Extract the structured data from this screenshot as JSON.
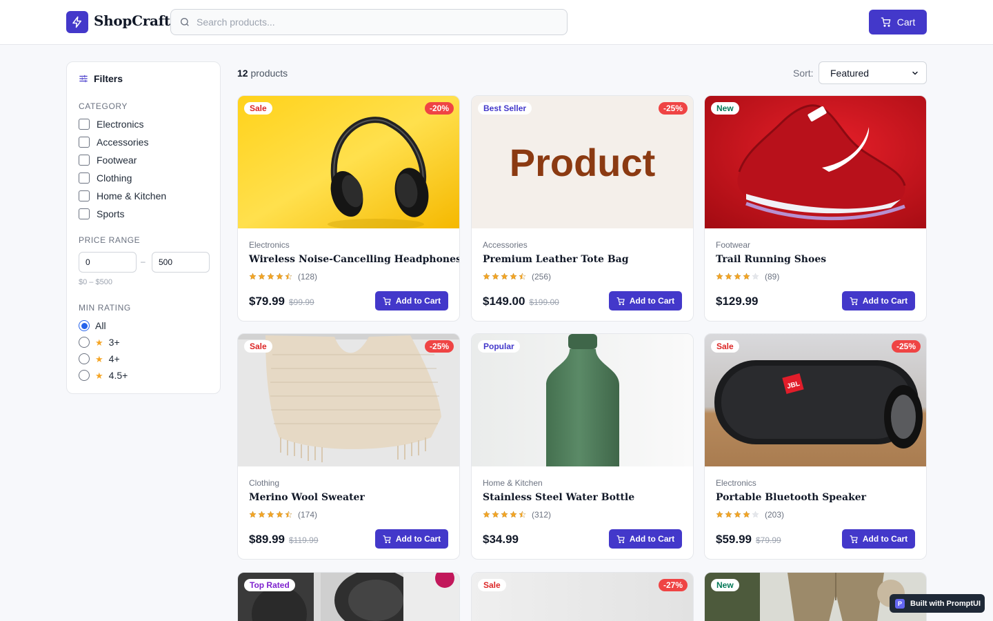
{
  "header": {
    "brand": "ShopCraft",
    "search_placeholder": "Search products...",
    "cart_label": "Cart"
  },
  "filters": {
    "title": "Filters",
    "category_label": "CATEGORY",
    "categories": [
      "Electronics",
      "Accessories",
      "Footwear",
      "Clothing",
      "Home & Kitchen",
      "Sports"
    ],
    "price_label": "PRICE RANGE",
    "price_min": "0",
    "price_max": "500",
    "price_dash": "–",
    "price_summary": "$0 – $500",
    "rating_label": "MIN RATING",
    "ratings": [
      {
        "label": "All",
        "selected": true,
        "star": false
      },
      {
        "label": "3+",
        "selected": false,
        "star": true
      },
      {
        "label": "4+",
        "selected": false,
        "star": true
      },
      {
        "label": "4.5+",
        "selected": false,
        "star": true
      }
    ]
  },
  "toolbar": {
    "count_num": "12",
    "count_word": "products",
    "sort_label": "Sort:",
    "sort_value": "Featured"
  },
  "products": [
    {
      "badge": "Sale",
      "discount": "-20%",
      "category": "Electronics",
      "name": "Wireless Noise-Cancelling Headphones",
      "rating": 4.5,
      "reviews": "(128)",
      "price": "$79.99",
      "old_price": "$99.99",
      "image": "headphones"
    },
    {
      "badge": "Best Seller",
      "discount": "-25%",
      "category": "Accessories",
      "name": "Premium Leather Tote Bag",
      "rating": 4.5,
      "reviews": "(256)",
      "price": "$149.00",
      "old_price": "$199.00",
      "image": "placeholder",
      "image_text": "Product"
    },
    {
      "badge": "New",
      "discount": "",
      "category": "Footwear",
      "name": "Trail Running Shoes",
      "rating": 4,
      "reviews": "(89)",
      "price": "$129.99",
      "old_price": "",
      "image": "shoe"
    },
    {
      "badge": "Sale",
      "discount": "-25%",
      "category": "Clothing",
      "name": "Merino Wool Sweater",
      "rating": 4.5,
      "reviews": "(174)",
      "price": "$89.99",
      "old_price": "$119.99",
      "image": "sweater"
    },
    {
      "badge": "Popular",
      "discount": "",
      "category": "Home & Kitchen",
      "name": "Stainless Steel Water Bottle",
      "rating": 4.5,
      "reviews": "(312)",
      "price": "$34.99",
      "old_price": "",
      "image": "bottle"
    },
    {
      "badge": "Sale",
      "discount": "-25%",
      "category": "Electronics",
      "name": "Portable Bluetooth Speaker",
      "rating": 4,
      "reviews": "(203)",
      "price": "$59.99",
      "old_price": "$79.99",
      "image": "speaker",
      "image_text": "JBL"
    },
    {
      "badge": "Top Rated",
      "discount": "",
      "image": "yoga"
    },
    {
      "badge": "Sale",
      "discount": "-27%",
      "image": "plain"
    },
    {
      "badge": "New",
      "discount": "",
      "image": "pants"
    }
  ],
  "add_to_cart": "Add to Cart",
  "built_with": "Built with PromptUI",
  "built_logo": "P",
  "colors": {
    "accent": "#4338ca",
    "sale": "#dc2626",
    "bestseller": "#4338ca",
    "new": "#047857",
    "popular": "#4338ca",
    "toprated": "#7e22ce",
    "star": "#f5a524"
  }
}
